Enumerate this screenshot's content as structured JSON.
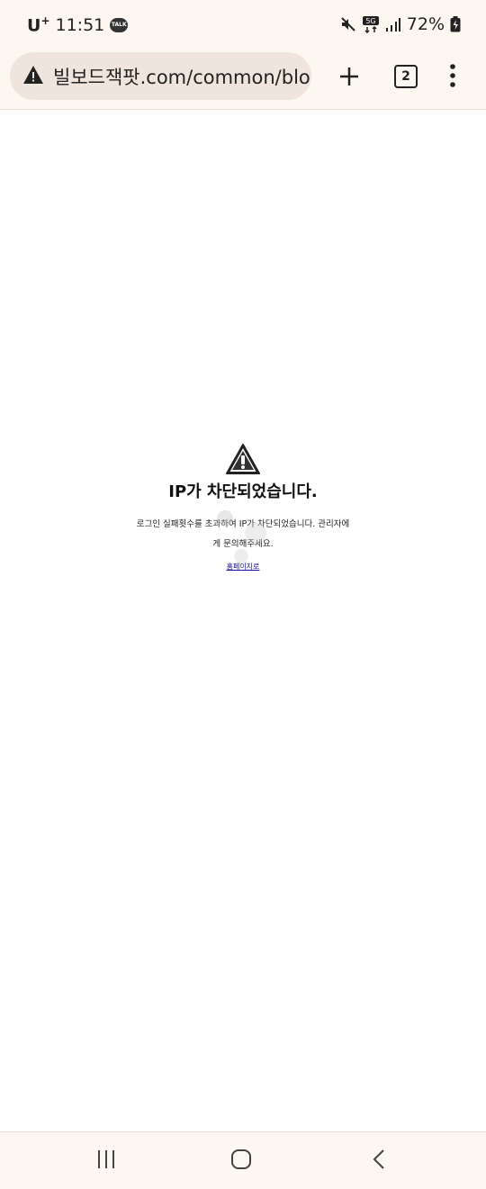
{
  "status_bar": {
    "carrier": "U",
    "carrier_mark": "+",
    "time": "11:51",
    "talk_badge": "TALK",
    "network": "5G",
    "battery": "72%"
  },
  "browser": {
    "url": "빌보드잭팟.com/common/bloc",
    "tab_count": "2"
  },
  "page": {
    "title": "IP가 차단되었습니다.",
    "message_line1": "로그인 실패횟수를 초과하여 IP가 차단되었습니다. 관리자에",
    "message_line2": "게 문의해주세요.",
    "home_link": "홈페이지로"
  },
  "colors": {
    "chrome_bg": "#fdf7f2",
    "url_bar_bg": "#efe5dc",
    "link": "#1a0dab"
  }
}
